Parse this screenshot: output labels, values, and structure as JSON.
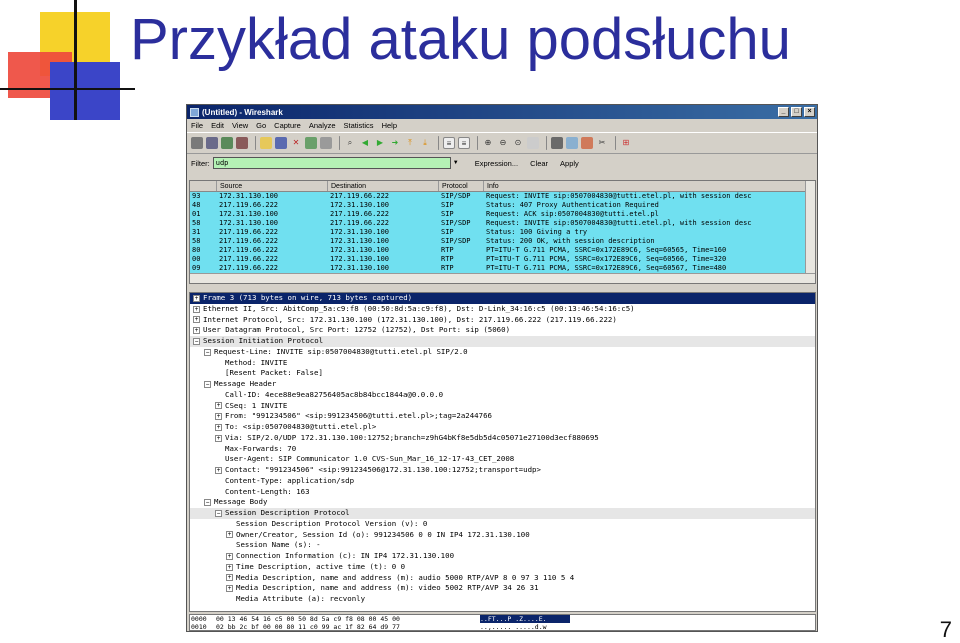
{
  "slide": {
    "title": "Przykład ataku podsłuchu",
    "page_number": "7"
  },
  "window": {
    "title": "(Untitled) - Wireshark",
    "controls": [
      "_",
      "□",
      "×"
    ]
  },
  "menu": [
    "File",
    "Edit",
    "View",
    "Go",
    "Capture",
    "Analyze",
    "Statistics",
    "Help"
  ],
  "filter": {
    "label": "Filter:",
    "value": "udp",
    "expression_label": "Expression...",
    "clear_label": "Clear",
    "apply_label": "Apply"
  },
  "packet_list": {
    "headers": [
      "",
      "Source",
      "Destination",
      "Protocol",
      "Info"
    ],
    "rows": [
      {
        "no": "93",
        "src": "172.31.130.100",
        "dst": "217.119.66.222",
        "proto": "SIP/SDP",
        "info": "Request: INVITE sip:0507004830@tutti.etel.pl, with session desc",
        "color": "#70e0f0"
      },
      {
        "no": "48",
        "src": "217.119.66.222",
        "dst": "172.31.130.100",
        "proto": "SIP",
        "info": "Status: 407 Proxy Authentication Required",
        "color": "#70e0f0"
      },
      {
        "no": "01",
        "src": "172.31.130.100",
        "dst": "217.119.66.222",
        "proto": "SIP",
        "info": "Request: ACK sip:0507004830@tutti.etel.pl",
        "color": "#70e0f0"
      },
      {
        "no": "58",
        "src": "172.31.130.100",
        "dst": "217.119.66.222",
        "proto": "SIP/SDP",
        "info": "Request: INVITE sip:0507004830@tutti.etel.pl, with session desc",
        "color": "#70e0f0"
      },
      {
        "no": "31",
        "src": "217.119.66.222",
        "dst": "172.31.130.100",
        "proto": "SIP",
        "info": "Status: 100 Giving a try",
        "color": "#70e0f0"
      },
      {
        "no": "58",
        "src": "217.119.66.222",
        "dst": "172.31.130.100",
        "proto": "SIP/SDP",
        "info": "Status: 200 OK, with session description",
        "color": "#70e0f0"
      },
      {
        "no": "80",
        "src": "217.119.66.222",
        "dst": "172.31.130.100",
        "proto": "RTP",
        "info": "PT=ITU-T G.711 PCMA, SSRC=0x172E89C6, Seq=60565, Time=160",
        "color": "#70e0f0"
      },
      {
        "no": "00",
        "src": "217.119.66.222",
        "dst": "172.31.130.100",
        "proto": "RTP",
        "info": "PT=ITU-T G.711 PCMA, SSRC=0x172E89C6, Seq=60566, Time=320",
        "color": "#70e0f0"
      },
      {
        "no": "09",
        "src": "217.119.66.222",
        "dst": "172.31.130.100",
        "proto": "RTP",
        "info": "PT=ITU-T G.711 PCMA, SSRC=0x172E89C6, Seq=60567, Time=480",
        "color": "#70e0f0"
      }
    ]
  },
  "details": [
    {
      "indent": 0,
      "exp": "+",
      "text": "Frame 3 (713 bytes on wire, 713 bytes captured)",
      "state": "sel"
    },
    {
      "indent": 0,
      "exp": "+",
      "text": "Ethernet II, Src: AbitComp_5a:c9:f8 (00:50:8d:5a:c9:f8), Dst: D-Link_34:16:c5 (00:13:46:54:16:c5)",
      "state": ""
    },
    {
      "indent": 0,
      "exp": "+",
      "text": "Internet Protocol, Src: 172.31.130.100 (172.31.130.100), Dst: 217.119.66.222 (217.119.66.222)",
      "state": ""
    },
    {
      "indent": 0,
      "exp": "+",
      "text": "User Datagram Protocol, Src Port: 12752 (12752), Dst Port: sip (5060)",
      "state": ""
    },
    {
      "indent": 0,
      "exp": "-",
      "text": "Session Initiation Protocol",
      "state": "hl"
    },
    {
      "indent": 1,
      "exp": "-",
      "text": "Request-Line: INVITE sip:0507004830@tutti.etel.pl SIP/2.0",
      "state": ""
    },
    {
      "indent": 2,
      "exp": "",
      "text": "Method: INVITE",
      "state": ""
    },
    {
      "indent": 2,
      "exp": "",
      "text": "[Resent Packet: False]",
      "state": ""
    },
    {
      "indent": 1,
      "exp": "-",
      "text": "Message Header",
      "state": ""
    },
    {
      "indent": 2,
      "exp": "",
      "text": "Call-ID: 4ece88e9ea82756405ac8b84bcc1844a@0.0.0.0",
      "state": ""
    },
    {
      "indent": 2,
      "exp": "+",
      "text": "CSeq: 1 INVITE",
      "state": ""
    },
    {
      "indent": 2,
      "exp": "+",
      "text": "From: \"991234506\" <sip:991234506@tutti.etel.pl>;tag=2a244766",
      "state": ""
    },
    {
      "indent": 2,
      "exp": "+",
      "text": "To: <sip:0507004830@tutti.etel.pl>",
      "state": ""
    },
    {
      "indent": 2,
      "exp": "+",
      "text": "Via: SIP/2.0/UDP 172.31.130.100:12752;branch=z9hG4bKf8e5db5d4c05071e27100d3ecf880695",
      "state": ""
    },
    {
      "indent": 2,
      "exp": "",
      "text": "Max-Forwards: 70",
      "state": ""
    },
    {
      "indent": 2,
      "exp": "",
      "text": "User-Agent: SIP Communicator 1.0 CVS-Sun_Mar_16_12-17-43_CET_2008",
      "state": ""
    },
    {
      "indent": 2,
      "exp": "+",
      "text": "Contact: \"991234506\" <sip:991234506@172.31.130.100:12752;transport=udp>",
      "state": ""
    },
    {
      "indent": 2,
      "exp": "",
      "text": "Content-Type: application/sdp",
      "state": ""
    },
    {
      "indent": 2,
      "exp": "",
      "text": "Content-Length: 163",
      "state": ""
    },
    {
      "indent": 1,
      "exp": "-",
      "text": "Message Body",
      "state": ""
    },
    {
      "indent": 2,
      "exp": "-",
      "text": "Session Description Protocol",
      "state": "hl"
    },
    {
      "indent": 3,
      "exp": "",
      "text": "Session Description Protocol Version (v): 0",
      "state": ""
    },
    {
      "indent": 3,
      "exp": "+",
      "text": "Owner/Creator, Session Id (o): 991234506 0 0 IN IP4 172.31.130.100",
      "state": ""
    },
    {
      "indent": 3,
      "exp": "",
      "text": "Session Name (s): -",
      "state": ""
    },
    {
      "indent": 3,
      "exp": "+",
      "text": "Connection Information (c): IN IP4 172.31.130.100",
      "state": ""
    },
    {
      "indent": 3,
      "exp": "+",
      "text": "Time Description, active time (t): 0 0",
      "state": ""
    },
    {
      "indent": 3,
      "exp": "+",
      "text": "Media Description, name and address (m): audio 5000 RTP/AVP 8 0 97 3 110 5 4",
      "state": ""
    },
    {
      "indent": 3,
      "exp": "+",
      "text": "Media Description, name and address (m): video 5002 RTP/AVP 34 26 31",
      "state": ""
    },
    {
      "indent": 3,
      "exp": "",
      "text": "Media Attribute (a): recvonly",
      "state": ""
    }
  ],
  "hex": [
    {
      "off": "0000",
      "bytes": "00 13 46 54 16 c5 00 50  8d 5a c9 f8 08 00 45 00",
      "asc": "..FT...P .Z....E."
    },
    {
      "off": "0010",
      "bytes": "02 bb 2c bf 00 00 80 11  c0 99 ac 1f 82 64 d9 77",
      "asc": "..,..... .....d.w"
    }
  ],
  "colors": {
    "selection": "#0a246a",
    "filter_ok": "#b5f2b5",
    "sip_row": "#70e0f0",
    "title": "#2b2e9c"
  }
}
